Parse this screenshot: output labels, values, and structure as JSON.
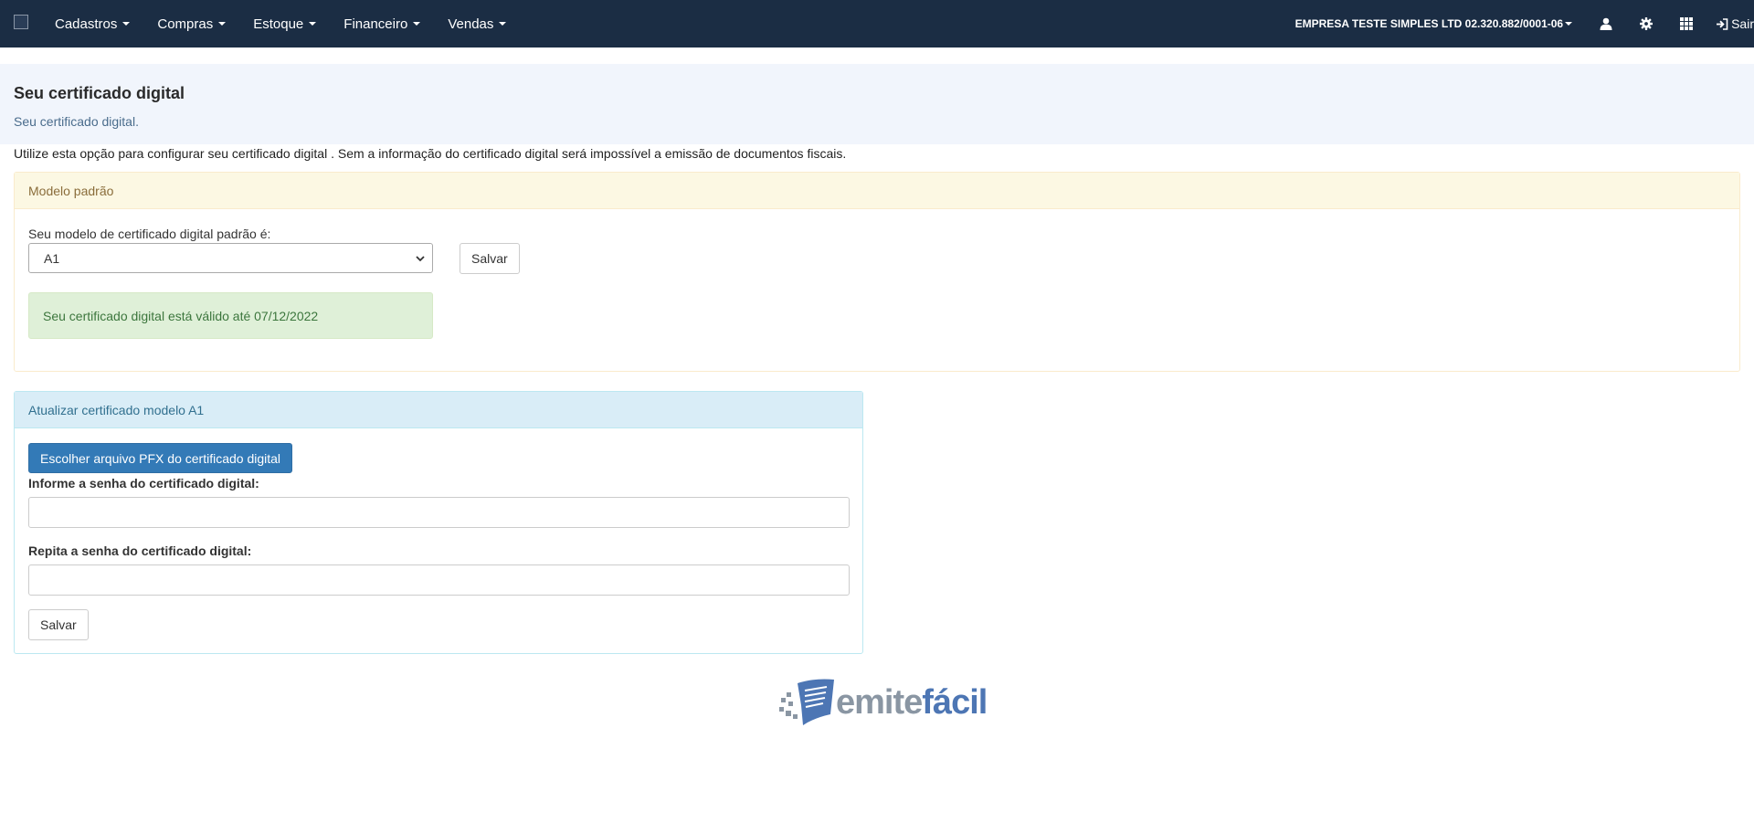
{
  "navbar": {
    "menu": [
      {
        "label": "Cadastros"
      },
      {
        "label": "Compras"
      },
      {
        "label": "Estoque"
      },
      {
        "label": "Financeiro"
      },
      {
        "label": "Vendas"
      }
    ],
    "company": "EMPRESA TESTE SIMPLES LTD 02.320.882/0001-06",
    "logout_label": "Sair"
  },
  "header": {
    "title": "Seu certificado digital",
    "subtitle": "Seu certificado digital."
  },
  "intro_text": "Utilize esta opção para configurar seu certificado digital . Sem a informação do certificado digital será impossível a emissão de documentos fiscais.",
  "default_model_panel": {
    "heading": "Modelo padrão",
    "label": "Seu modelo de certificado digital padrão é:",
    "selected": "A1",
    "save_label": "Salvar",
    "valid_message": "Seu certificado digital está válido até 07/12/2022"
  },
  "update_panel": {
    "heading": "Atualizar certificado modelo A1",
    "choose_file_label": "Escolher arquivo PFX do certificado digital",
    "password_label": "Informe a senha do certificado digital:",
    "password_value": "",
    "repeat_label": "Repita a senha do certificado digital:",
    "repeat_value": "",
    "save_label": "Salvar"
  },
  "footer": {
    "logo_part1": "emite",
    "logo_part2": "fácil"
  },
  "colors": {
    "navbar": "#1b2d44",
    "primary": "#337ab7",
    "success_bg": "#dff0d8",
    "warning_bg": "#fcf8e3",
    "info_bg": "#d9edf7"
  }
}
